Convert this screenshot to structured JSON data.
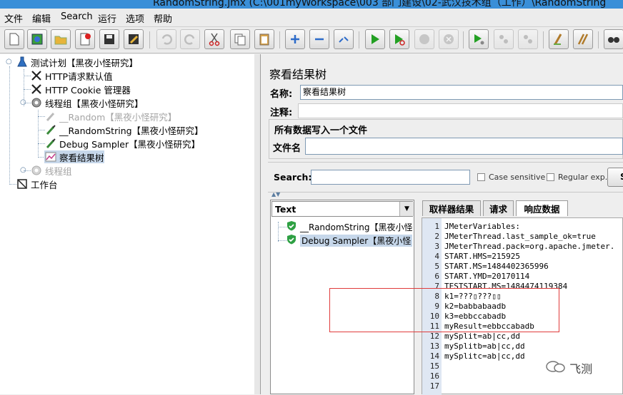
{
  "window": {
    "title": "RandomString.jmx (C:\\001myWorkspace\\003 部门建设\\02-武汉技术组（工作）\\RandomString"
  },
  "menu": [
    "文件",
    "编辑",
    "Search",
    "运行",
    "选项",
    "帮助"
  ],
  "toolbar": [
    "new",
    "templates",
    "open",
    "close",
    "save",
    "save-screenshot",
    "undo",
    "redo",
    "cut",
    "copy",
    "paste",
    "expand",
    "collapse",
    "toggle",
    "start",
    "start-no-pauses",
    "stop",
    "shutdown",
    "remote-start",
    "remote-stop",
    "remote-clear",
    "clear",
    "clear-all",
    "search"
  ],
  "tree": {
    "items": [
      {
        "label": "测试计划【黑夜小怪研究】"
      },
      {
        "label": "HTTP请求默认值"
      },
      {
        "label": "HTTP Cookie 管理器"
      },
      {
        "label": "线程组【黑夜小怪研究】"
      },
      {
        "label": "__Random【黑夜小怪研究】"
      },
      {
        "label": "__RandomString【黑夜小怪研究】"
      },
      {
        "label": "Debug Sampler【黑夜小怪研究】"
      },
      {
        "label": "察看结果树"
      },
      {
        "label": "线程组"
      },
      {
        "label": "工作台"
      }
    ]
  },
  "panel": {
    "title": "察看结果树",
    "name_label": "名称:",
    "name_value": "察看结果树",
    "comment_label": "注释:",
    "section_title": "所有数据写入一个文件",
    "file_label": "文件名",
    "search_label": "Search:",
    "case_sensitive": "Case sensitive",
    "regular_exp": "Regular exp.",
    "search_button": "S"
  },
  "renderer": {
    "selected": "Text"
  },
  "results": [
    "__RandomString【黑夜小怪",
    "Debug Sampler【黑夜小怪"
  ],
  "tabs": [
    "取样器结果",
    "请求",
    "响应数据"
  ],
  "active_tab": "响应数据",
  "response_lines": [
    "JMeterVariables:",
    "JMeterThread.last_sample_ok=true",
    "JMeterThread.pack=org.apache.jmeter.",
    "START.HMS=215925",
    "START.MS=1484402365996",
    "START.YMD=20170114",
    "TESTSTART.MS=1484474119384",
    "k1=???▯???▯▯",
    "k2=babbabaadb",
    "k3=ebbccabadb",
    "myResult=ebbccabadb",
    "mySplit=ab|cc,dd",
    "mySplitb=ab|cc,dd",
    "mySplitc=ab|cc,dd",
    "",
    "",
    ""
  ],
  "line_numbers": [
    "1",
    "2",
    "3",
    "4",
    "5",
    "6",
    "7",
    "8",
    "9",
    "10",
    "11",
    "12",
    "13",
    "14",
    "15",
    "16",
    "17"
  ],
  "watermark": "飞测",
  "colors": {
    "selection": "#c6d7ea",
    "gutter": "#dfe7f3",
    "highlight_box": "#e03b3b",
    "success": "#2ea043"
  }
}
